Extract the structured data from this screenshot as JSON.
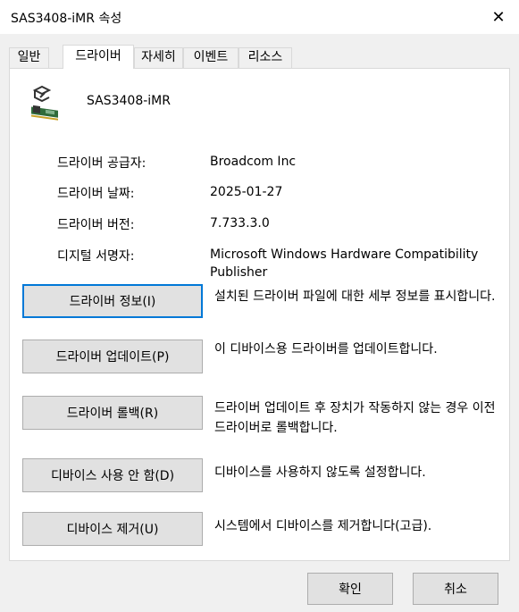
{
  "window": {
    "title": "SAS3408-iMR 속성",
    "close_glyph": "✕"
  },
  "tabs": [
    {
      "label": "일반",
      "active": false
    },
    {
      "label": "드라이버",
      "active": true
    },
    {
      "label": "자세히",
      "active": false
    },
    {
      "label": "이벤트",
      "active": false
    },
    {
      "label": "리소스",
      "active": false
    }
  ],
  "device": {
    "name": "SAS3408-iMR",
    "icon": "storage-controller-icon"
  },
  "info": {
    "provider_label": "드라이버 공급자:",
    "provider_value": "Broadcom Inc",
    "date_label": "드라이버 날짜:",
    "date_value": "2025-01-27",
    "version_label": "드라이버 버전:",
    "version_value": "7.733.3.0",
    "signer_label": "디지털 서명자:",
    "signer_value": "Microsoft Windows Hardware Compatibility Publisher"
  },
  "actions": [
    {
      "label": "드라이버 정보(I)",
      "desc": "설치된 드라이버 파일에 대한 세부 정보를 표시합니다."
    },
    {
      "label": "드라이버 업데이트(P)",
      "desc": "이 디바이스용 드라이버를 업데이트합니다."
    },
    {
      "label": "드라이버 롤백(R)",
      "desc": "드라이버 업데이트 후 장치가 작동하지 않는 경우 이전 드라이버로 롤백합니다."
    },
    {
      "label": "디바이스 사용 안 함(D)",
      "desc": "디바이스를 사용하지 않도록 설정합니다."
    },
    {
      "label": "디바이스 제거(U)",
      "desc": "시스템에서 디바이스를 제거합니다(고급)."
    }
  ],
  "footer": {
    "ok_label": "확인",
    "cancel_label": "취소"
  },
  "colors": {
    "focus_border": "#0078d7",
    "button_face": "#e1e1e1",
    "dialog_bg": "#f0f0f0"
  }
}
